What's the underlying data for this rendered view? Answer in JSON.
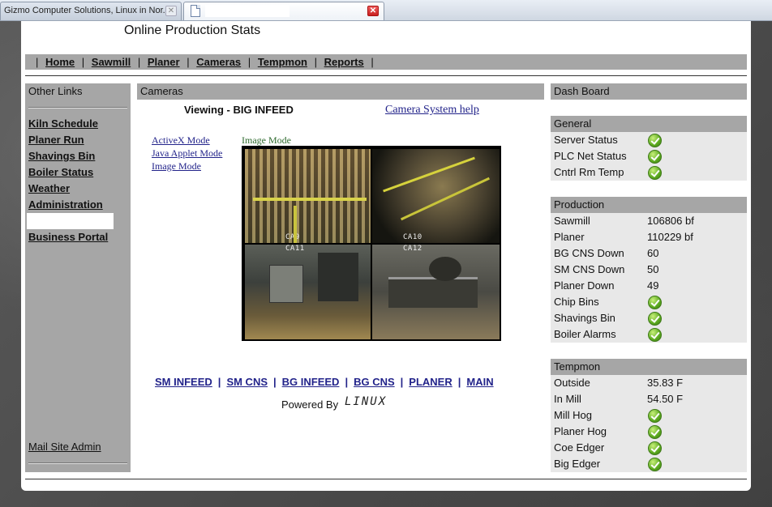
{
  "browser": {
    "tabs": [
      {
        "title": "Gizmo Computer Solutions, Linux in Nor..."
      },
      {
        "title": ""
      }
    ]
  },
  "site": {
    "title": "Online Production Stats"
  },
  "nav": {
    "items": [
      "Home",
      "Sawmill",
      "Planer",
      "Cameras",
      "Tempmon",
      "Reports"
    ],
    "separator": "|"
  },
  "sidebar": {
    "header": "Other Links",
    "links": [
      "Kiln Schedule",
      "Planer Run",
      "Shavings Bin",
      "Boiler Status",
      "Weather",
      "Administration",
      "Business Portal"
    ],
    "admin_link": "Mail Site Admin"
  },
  "cameras": {
    "header": "Cameras",
    "viewing_label": "Viewing -",
    "viewing_value": "BIG INFEED",
    "help_link": "Camera System help",
    "mode_links": [
      "ActiveX Mode",
      "Java Applet Mode",
      "Image Mode"
    ],
    "current_mode": "Image Mode",
    "feeds": [
      "CA9",
      "CA10",
      "CA11",
      "CA12"
    ],
    "camera_nav": [
      "SM INFEED",
      "SM CNS",
      "BG INFEED",
      "BG CNS",
      "PLANER",
      "MAIN"
    ],
    "nav_separator": "|",
    "powered_by": "Powered By",
    "powered_logo": "LINUX"
  },
  "dashboard": {
    "header": "Dash Board",
    "general": {
      "title": "General",
      "rows": [
        {
          "label": "Server Status",
          "status": "ok"
        },
        {
          "label": "PLC Net Status",
          "status": "ok"
        },
        {
          "label": "Cntrl Rm Temp",
          "status": "ok"
        }
      ]
    },
    "production": {
      "title": "Production",
      "rows": [
        {
          "label": "Sawmill",
          "value": "106806 bf"
        },
        {
          "label": "Planer",
          "value": "110229 bf"
        },
        {
          "label": "BG CNS Down",
          "value": "60"
        },
        {
          "label": "SM CNS Down",
          "value": "50"
        },
        {
          "label": "Planer Down",
          "value": "49"
        },
        {
          "label": "Chip Bins",
          "status": "ok"
        },
        {
          "label": "Shavings Bin",
          "status": "ok"
        },
        {
          "label": "Boiler Alarms",
          "status": "ok"
        }
      ]
    },
    "tempmon": {
      "title": "Tempmon",
      "rows": [
        {
          "label": "Outside",
          "value": "35.83 F"
        },
        {
          "label": "In Mill",
          "value": "54.50 F"
        },
        {
          "label": "Mill Hog",
          "status": "ok"
        },
        {
          "label": "Planer Hog",
          "status": "ok"
        },
        {
          "label": "Coe Edger",
          "status": "ok"
        },
        {
          "label": "Big Edger",
          "status": "ok"
        }
      ]
    }
  },
  "colors": {
    "bar_gray": "#a6a6a6",
    "panel_gray": "#e8e8e8",
    "link_blue": "#22238a",
    "status_green": "#5aa81e"
  }
}
